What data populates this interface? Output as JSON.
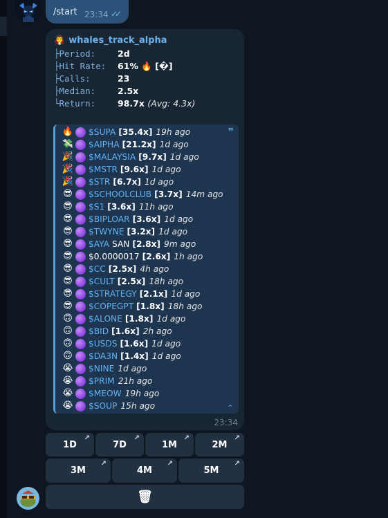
{
  "outgoing": {
    "text": "/start",
    "time": "23:34",
    "ticks": "✓✓"
  },
  "card": {
    "icon": "🧛",
    "title": "whales_track_alpha",
    "stats": [
      {
        "label": "├Period:",
        "value": "2d",
        "extra": ""
      },
      {
        "label": "├Hit Rate:",
        "value": "61% 🔥 [�]",
        "extra": ""
      },
      {
        "label": "├Calls:",
        "value": "23",
        "extra": ""
      },
      {
        "label": "├Median:",
        "value": "2.5x",
        "extra": ""
      },
      {
        "label": "└Return:",
        "value": "98.7x",
        "extra": "(Avg: 4.3x)"
      }
    ],
    "quote_mark": "❞",
    "collapse_icon": "⌃",
    "time": "23:34"
  },
  "calls": [
    {
      "emoji": "🔥",
      "symbol": "$SUPA",
      "mult": "[35.4x]",
      "ago": "19h ago",
      "white": false
    },
    {
      "emoji": "💸",
      "symbol": "$AIPHA",
      "mult": "[21.2x]",
      "ago": "1d ago",
      "white": false
    },
    {
      "emoji": "🎉",
      "symbol": "$MALAYSIA",
      "mult": "[9.7x]",
      "ago": "1d ago",
      "white": false
    },
    {
      "emoji": "🎉",
      "symbol": "$MSTR",
      "mult": "[9.6x]",
      "ago": "1d ago",
      "white": false
    },
    {
      "emoji": "🎉",
      "symbol": "$STR",
      "mult": "[6.7x]",
      "ago": "1d ago",
      "white": false
    },
    {
      "emoji": "😎",
      "symbol": "$SCHOOLCLUB",
      "mult": "[3.7x]",
      "ago": "14m ago",
      "white": false
    },
    {
      "emoji": "😎",
      "symbol": "$S1",
      "mult": "[3.6x]",
      "ago": "11h ago",
      "white": false
    },
    {
      "emoji": "😎",
      "symbol": "$BIPLOAR",
      "mult": "[3.6x]",
      "ago": "1d ago",
      "white": false
    },
    {
      "emoji": "😎",
      "symbol": "$TWYNE",
      "mult": "[3.2x]",
      "ago": "1d ago",
      "white": false
    },
    {
      "emoji": "😎",
      "symbol": "$AYA",
      "suffix": "SAN",
      "mult": "[2.8x]",
      "ago": "9m ago",
      "white": false
    },
    {
      "emoji": "😎",
      "symbol": "$0.0000017",
      "mult": "[2.6x]",
      "ago": "1h ago",
      "white": true
    },
    {
      "emoji": "😎",
      "symbol": "$CC",
      "mult": "[2.5x]",
      "ago": "4h ago",
      "white": false
    },
    {
      "emoji": "😎",
      "symbol": "$CULT",
      "mult": "[2.5x]",
      "ago": "18h ago",
      "white": false
    },
    {
      "emoji": "😎",
      "symbol": "$STRATEGY",
      "mult": "[2.1x]",
      "ago": "1d ago",
      "white": false
    },
    {
      "emoji": "😎",
      "symbol": "$COPEGPT",
      "mult": "[1.8x]",
      "ago": "18h ago",
      "white": false
    },
    {
      "emoji": "🙃",
      "symbol": "$ALONE",
      "mult": "[1.8x]",
      "ago": "1d ago",
      "white": false
    },
    {
      "emoji": "🙃",
      "symbol": "$BID",
      "mult": "[1.6x]",
      "ago": "2h ago",
      "white": false
    },
    {
      "emoji": "🙃",
      "symbol": "$USDS",
      "mult": "[1.6x]",
      "ago": "1d ago",
      "white": false
    },
    {
      "emoji": "🙃",
      "symbol": "$DA3N",
      "mult": "[1.4x]",
      "ago": "1d ago",
      "white": false
    },
    {
      "emoji": "😭",
      "symbol": "$NINE",
      "mult": "",
      "ago": "1d ago",
      "white": false
    },
    {
      "emoji": "😭",
      "symbol": "$PRIM",
      "mult": "",
      "ago": "21h ago",
      "white": false
    },
    {
      "emoji": "😭",
      "symbol": "$MEOW",
      "mult": "",
      "ago": "19h ago",
      "white": false
    },
    {
      "emoji": "😭",
      "symbol": "$SOUP",
      "mult": "",
      "ago": "15h ago",
      "white": false
    }
  ],
  "keyboard": {
    "row1": [
      "1D",
      "7D",
      "1M",
      "2M"
    ],
    "row2": [
      "3M",
      "4M",
      "5M"
    ],
    "row3": [
      "🗑"
    ],
    "link_icon": "↗"
  },
  "colors": {
    "background": "#0e1621",
    "bubble_in": "#182533",
    "bubble_out": "#2b5278",
    "accent": "#6cb1ec",
    "quote_bg": "#1e3550",
    "button_bg": "#213141"
  }
}
